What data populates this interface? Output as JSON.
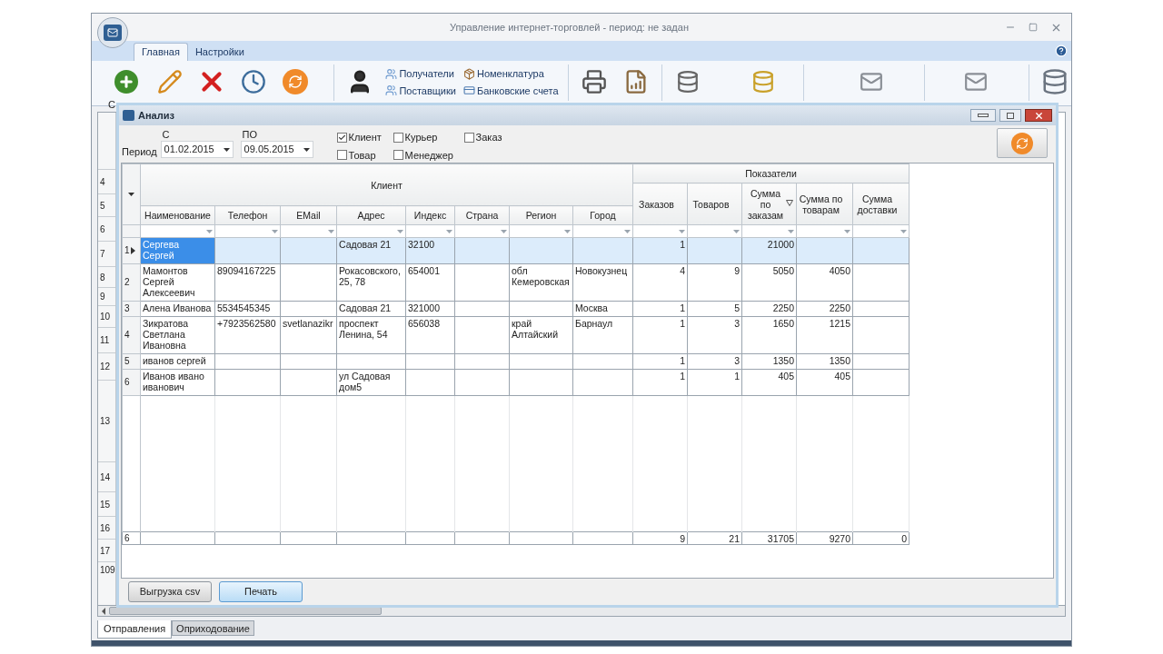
{
  "window": {
    "title": "Управление интернет-торговлей  - период: не задан"
  },
  "ribbon": {
    "tabs": [
      {
        "label": "Главная",
        "selected": true
      },
      {
        "label": "Настройки",
        "selected": false
      }
    ],
    "first_button_label": "С",
    "links": [
      "Получатели",
      "Поставщики",
      "Номенклатура",
      "Банковские счета"
    ]
  },
  "background_grid": {
    "row_numbers": [
      "4",
      "5",
      "6",
      "7",
      "8",
      "9",
      "10",
      "11",
      "12",
      "13",
      "14",
      "15",
      "16",
      "17",
      "109"
    ]
  },
  "dialog": {
    "title": "Анализ",
    "period_label": "Период",
    "from_label": "С",
    "to_label": "ПО",
    "from_value": "01.02.2015",
    "to_value": "09.05.2015",
    "checkboxes": [
      {
        "label": "Клиент",
        "checked": true
      },
      {
        "label": "Курьер",
        "checked": false
      },
      {
        "label": "Заказ",
        "checked": false
      },
      {
        "label": "Товар",
        "checked": false
      },
      {
        "label": "Менеджер",
        "checked": false
      }
    ],
    "table": {
      "groups": [
        {
          "label": "Клиент",
          "kind": "text",
          "columns": [
            {
              "label": "Наименование",
              "sorted": false
            },
            {
              "label": "Телефон",
              "sorted": false
            },
            {
              "label": "EMail",
              "sorted": false
            },
            {
              "label": "Адрес",
              "sorted": false
            },
            {
              "label": "Индекс",
              "sorted": false
            },
            {
              "label": "Страна",
              "sorted": false
            },
            {
              "label": "Регион",
              "sorted": false
            },
            {
              "label": "Город",
              "sorted": false
            }
          ]
        },
        {
          "label": "Показатели",
          "kind": "number",
          "columns": [
            {
              "label": "Заказов",
              "sorted": false
            },
            {
              "label": "Товаров",
              "sorted": false
            },
            {
              "label": "Сумма по заказам",
              "sorted": true
            },
            {
              "label": "Сумма по товарам",
              "sorted": false
            },
            {
              "label": "Сумма доставки",
              "sorted": false
            }
          ]
        }
      ],
      "rows": [
        {
          "number": "1",
          "selected": true,
          "cells": [
            "Сергева Сергей",
            null,
            null,
            "Садовая 21",
            "32100",
            null,
            null,
            null,
            "1",
            null,
            "21000",
            null,
            null
          ]
        },
        {
          "number": "2",
          "selected": false,
          "cells": [
            "Мамонтов Сергей Алексеевич",
            "89094167225",
            null,
            "Рокасовского, 25, 78",
            "654001",
            null,
            "обл Кемеровская",
            "Новокузнец",
            "4",
            "9",
            "5050",
            "4050",
            null
          ]
        },
        {
          "number": "3",
          "selected": false,
          "cells": [
            "Алена Иванова",
            "5534545345",
            null,
            "Садовая 21",
            "321000",
            null,
            null,
            "Москва",
            "1",
            "5",
            "2250",
            "2250",
            null
          ]
        },
        {
          "number": "4",
          "selected": false,
          "cells": [
            "Зикратова Светлана Ивановна",
            "+7923562580",
            "svetlanazikr",
            "проспект Ленина, 54",
            "656038",
            null,
            "край Алтайский",
            "Барнаул",
            "1",
            "3",
            "1650",
            "1215",
            null
          ]
        },
        {
          "number": "5",
          "selected": false,
          "cells": [
            "иванов сергей",
            null,
            null,
            null,
            null,
            null,
            null,
            null,
            "1",
            "3",
            "1350",
            "1350",
            null
          ]
        },
        {
          "number": "6",
          "selected": false,
          "cells": [
            "Иванов ивано иванович",
            null,
            null,
            "ул Садовая дом5",
            null,
            null,
            null,
            null,
            "1",
            "1",
            "405",
            "405",
            null
          ]
        }
      ],
      "footer": {
        "number": "6",
        "cells": [
          null,
          null,
          null,
          null,
          null,
          null,
          null,
          null,
          "9",
          "21",
          "31705",
          "9270",
          "0"
        ]
      }
    },
    "buttons": [
      {
        "label": "Выгрузка csv",
        "hovered": false
      },
      {
        "label": "Печать",
        "hovered": true
      }
    ]
  },
  "bottom_tabs": [
    {
      "label": "Отправления",
      "selected": true
    },
    {
      "label": "Оприходование",
      "selected": false
    }
  ]
}
